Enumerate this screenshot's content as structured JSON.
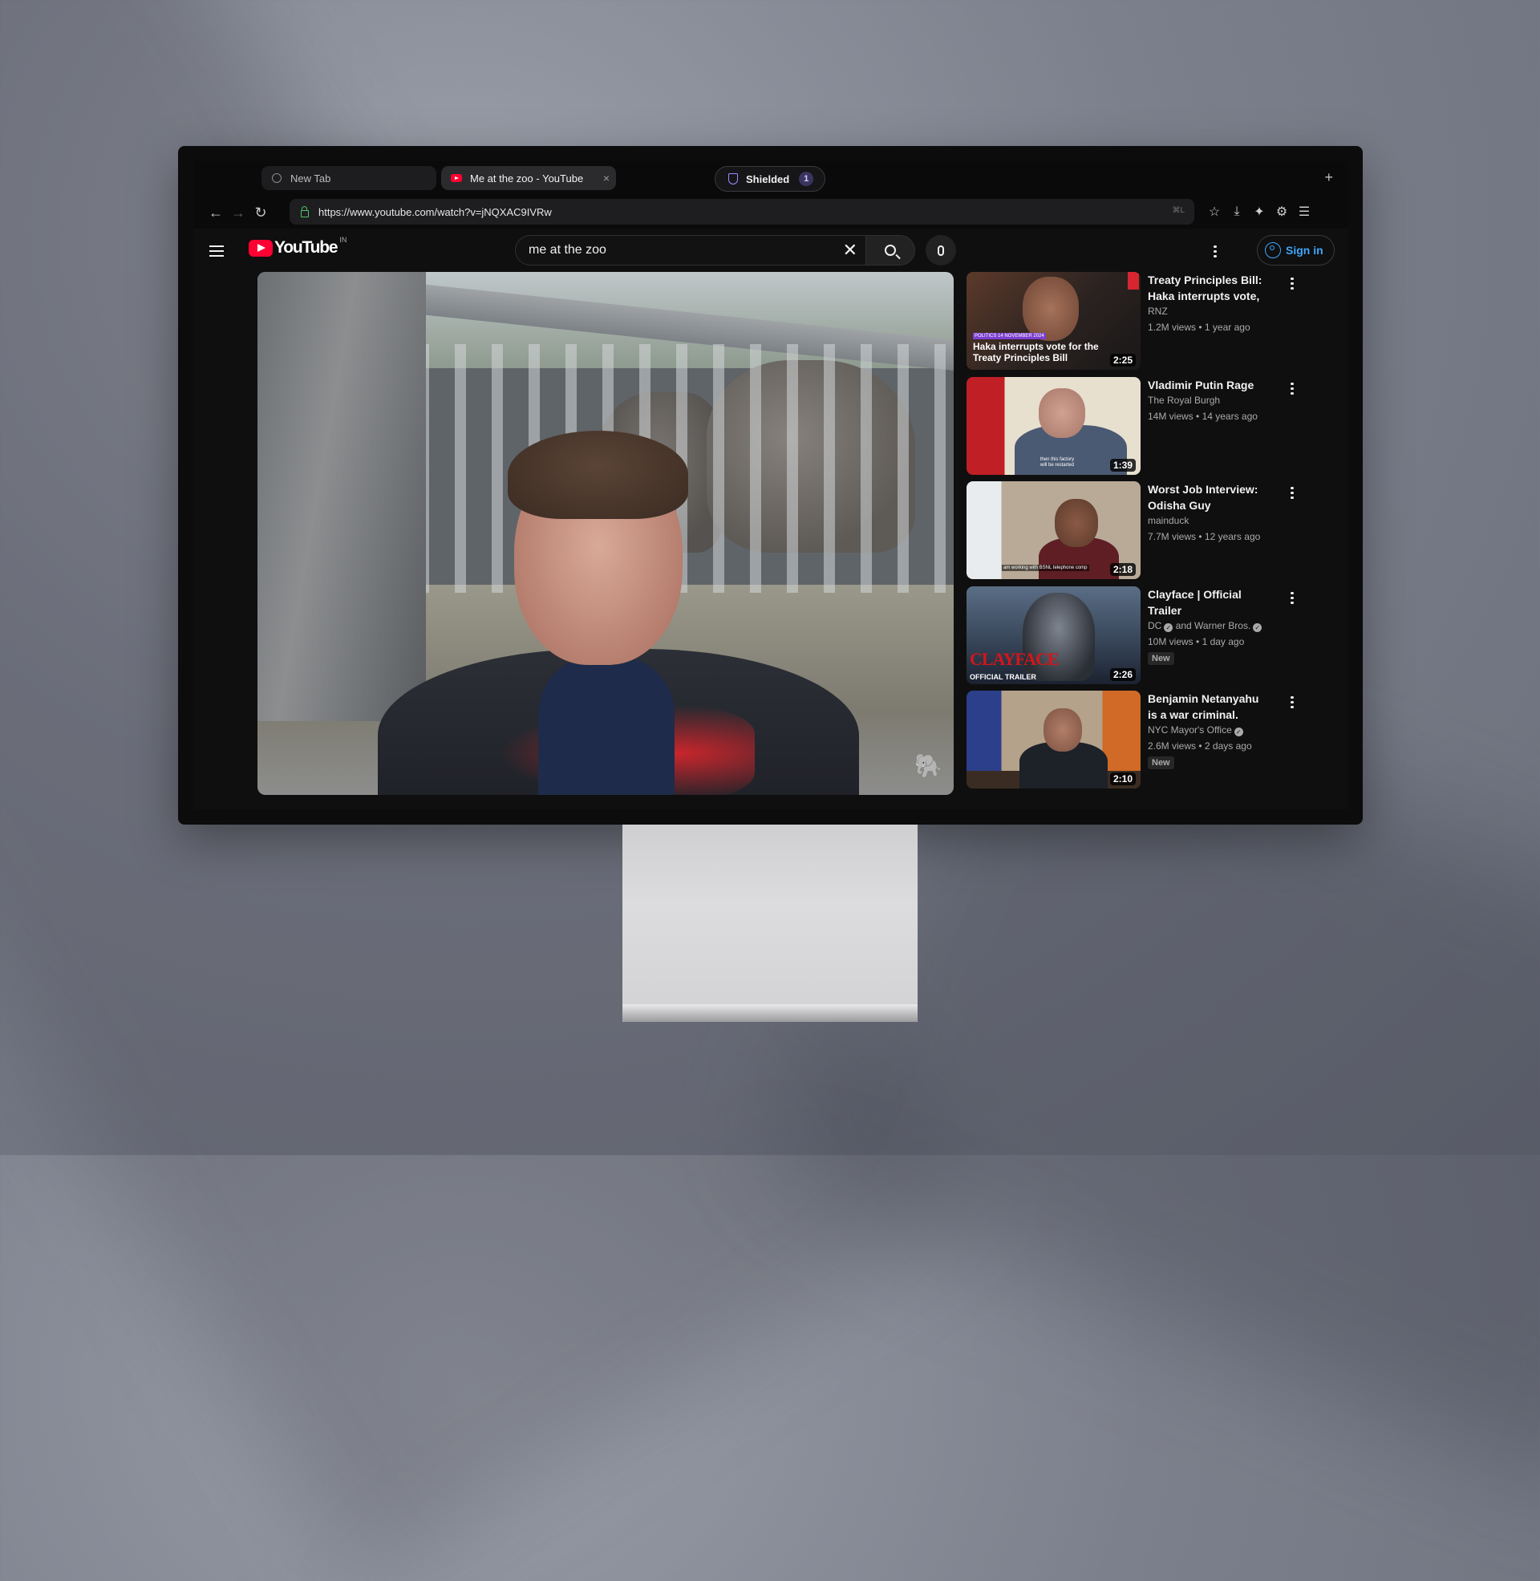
{
  "browser": {
    "tabs": [
      {
        "label": "New Tab",
        "active": false
      },
      {
        "label": "Me at the zoo - YouTube",
        "active": true
      }
    ],
    "shield": {
      "label": "Shielded",
      "count": "1"
    },
    "url": "https://www.youtube.com/watch?v=jNQXAC9IVRw",
    "url_shortcut": "⌘L"
  },
  "youtube": {
    "logo_text": "YouTube",
    "region": "IN",
    "search": {
      "value": "me at the zoo",
      "placeholder": "Search"
    },
    "signin_label": "Sign in",
    "player": {
      "title": "Me at the zoo"
    },
    "recommendations": [
      {
        "title": "Treaty Principles Bill: Haka interrupts vote, ...",
        "channel": "RNZ",
        "verified": false,
        "views": "1.2M views",
        "age": "1 year ago",
        "duration": "2:25",
        "new": false,
        "thumb_caption": "Haka interrupts vote for the Treaty Principles Bill",
        "thumb_tag": "POLITICS  14 NOVEMBER 2024"
      },
      {
        "title": "Vladimir Putin Rage",
        "channel": "The Royal Burgh",
        "verified": false,
        "views": "14M views",
        "age": "14 years ago",
        "duration": "1:39",
        "new": false,
        "thumb_caption": "then this factory will be restarted"
      },
      {
        "title": "Worst Job Interview: Odisha Guy",
        "channel": "mainduck",
        "verified": false,
        "views": "7.7M views",
        "age": "12 years ago",
        "duration": "2:18",
        "new": false,
        "thumb_caption": "am working with BSNL telephone comp"
      },
      {
        "title": "Clayface | Official Trailer",
        "channel": "DC",
        "channel2": "and Warner Bros.",
        "verified": true,
        "views": "10M views",
        "age": "1 day ago",
        "duration": "2:26",
        "new": true,
        "new_label": "New",
        "thumb_title": "CLAYFACE",
        "thumb_sub": "OFFICIAL TRAILER"
      },
      {
        "title": "Benjamin Netanyahu is a war criminal.",
        "channel": "NYC Mayor's Office",
        "verified": true,
        "views": "2.6M views",
        "age": "2 days ago",
        "duration": "2:10",
        "new": true,
        "new_label": "New"
      }
    ]
  },
  "colors": {
    "brand_red": "#ff0033",
    "link_blue": "#3ea6ff",
    "shield_purple": "#9b8cff",
    "page_bg": "#0f0f0f"
  }
}
